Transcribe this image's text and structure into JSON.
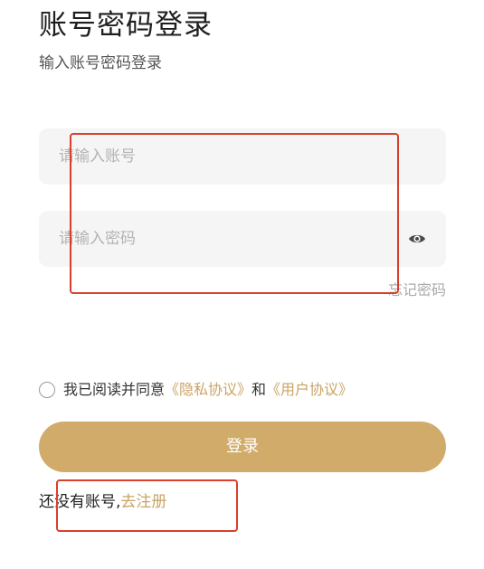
{
  "header": {
    "title": "账号密码登录",
    "subtitle": "输入账号密码登录"
  },
  "form": {
    "account_placeholder": "请输入账号",
    "password_placeholder": "请输入密码",
    "password_toggle_icon": "eye-icon",
    "forgot_label": "忘记密码"
  },
  "agreement": {
    "prefix": "我已阅读并同意",
    "privacy_link": "《隐私协议》",
    "conjunction": "和",
    "user_link": "《用户协议》"
  },
  "actions": {
    "login_label": "登录"
  },
  "register": {
    "prompt": "还没有账号,",
    "link": "去注册"
  },
  "colors": {
    "accent": "#d1ab6a",
    "link": "#c9a366",
    "field_bg": "#f5f5f5",
    "annotation": "#d9402b"
  }
}
